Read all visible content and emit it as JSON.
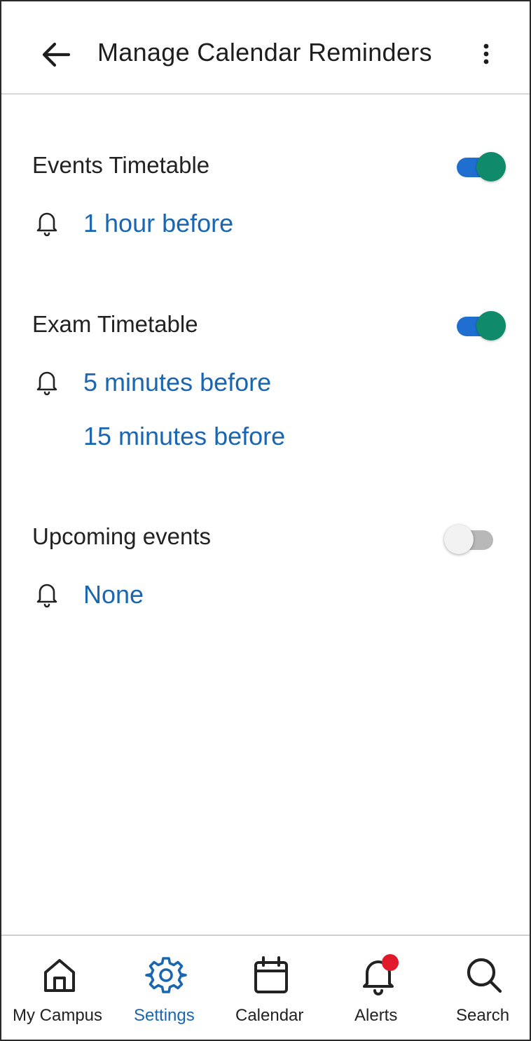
{
  "header": {
    "title": "Manage Calendar Reminders"
  },
  "sections": [
    {
      "title": "Events Timetable",
      "enabled": true,
      "reminders": [
        "1 hour before"
      ]
    },
    {
      "title": "Exam Timetable",
      "enabled": true,
      "reminders": [
        "5 minutes before",
        "15 minutes before"
      ]
    },
    {
      "title": "Upcoming events",
      "enabled": false,
      "reminders": [
        "None"
      ]
    }
  ],
  "bottom_nav": {
    "items": [
      {
        "label": "My Campus",
        "icon": "home-icon",
        "active": false
      },
      {
        "label": "Settings",
        "icon": "gear-icon",
        "active": true
      },
      {
        "label": "Calendar",
        "icon": "calendar-icon",
        "active": false
      },
      {
        "label": "Alerts",
        "icon": "bell-icon",
        "active": false,
        "has_badge": true
      },
      {
        "label": "Search",
        "icon": "search-icon",
        "active": false
      }
    ]
  },
  "colors": {
    "accent": "#1a66b0",
    "toggle_track_on": "#1e6fd0",
    "toggle_thumb_on": "#0f8a6a",
    "badge": "#e0192d"
  }
}
